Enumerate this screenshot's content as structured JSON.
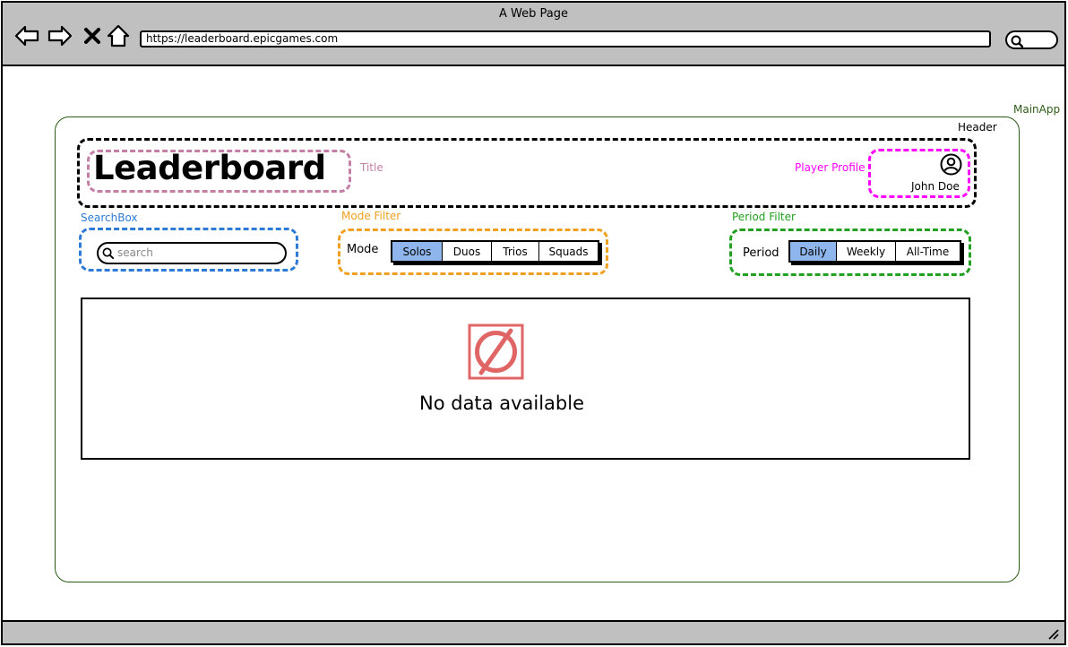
{
  "browser": {
    "window_title": "A Web Page",
    "url": "https://leaderboard.epicgames.com"
  },
  "annotations": {
    "main_app": "MainApp",
    "header": "Header",
    "title": "Title",
    "player_profile": "Player Profile",
    "search_box": "SearchBox",
    "mode_filter": "Mode Filter",
    "period_filter": "Period Filter"
  },
  "header": {
    "title": "Leaderboard",
    "player_name": "John Doe"
  },
  "search": {
    "placeholder": "search"
  },
  "mode_filter": {
    "label": "Mode",
    "options": [
      "Solos",
      "Duos",
      "Trios",
      "Squads"
    ],
    "selected": "Solos"
  },
  "period_filter": {
    "label": "Period",
    "options": [
      "Daily",
      "Weekly",
      "All-Time"
    ],
    "selected": "Daily"
  },
  "data_panel": {
    "empty_message": "No data available",
    "icon": "no-entry-icon"
  },
  "colors": {
    "selected_option": "#8fb6ec",
    "main_app_border": "#2d5a16",
    "title_outline": "#c47fa6",
    "profile_outline": "#ff00ff",
    "search_outline": "#2e7bd6",
    "mode_outline": "#f0a020",
    "period_outline": "#22a022",
    "empty_icon": "#e06666"
  }
}
